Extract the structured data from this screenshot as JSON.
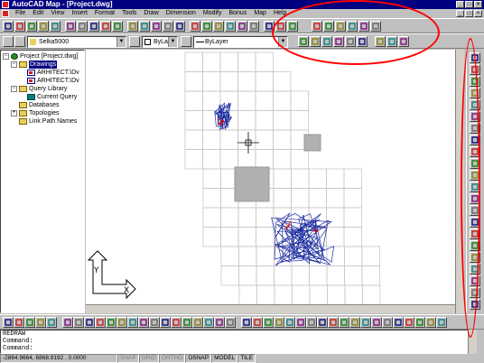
{
  "window": {
    "title": "AutoCAD Map - [Project.dwg]",
    "controls": [
      "_",
      "□",
      "×"
    ],
    "doc_controls": [
      "_",
      "□",
      "×"
    ]
  },
  "menu": [
    "File",
    "Edit",
    "View",
    "Insert",
    "Format",
    "Tools",
    "Draw",
    "Dimension",
    "Modify",
    "Bonus",
    "Map",
    "Help"
  ],
  "layer_bar": {
    "layer": "Selka5000",
    "color": "ByLayer",
    "linetype": "ByLayer"
  },
  "project_tree": [
    {
      "label": "Project [Project.dwg]",
      "level": 0,
      "expander": "−",
      "icon": "globe-icon"
    },
    {
      "label": "Drawings",
      "level": 1,
      "expander": "−",
      "icon": "folder-icon",
      "selected": true
    },
    {
      "label": "ARHITECT.\\Dv",
      "level": 2,
      "expander": "",
      "icon": "drawing-icon"
    },
    {
      "label": "ARHITECT.\\Dv",
      "level": 2,
      "expander": "",
      "icon": "drawing-icon"
    },
    {
      "label": "Query Library",
      "level": 1,
      "expander": "−",
      "icon": "folder-icon"
    },
    {
      "label": "Current Query",
      "level": 2,
      "expander": "",
      "icon": "query-icon"
    },
    {
      "label": "Databases",
      "level": 1,
      "expander": "",
      "icon": "folder-icon"
    },
    {
      "label": "Topologies",
      "level": 1,
      "expander": "+",
      "icon": "folder-icon"
    },
    {
      "label": "Link Path Names",
      "level": 1,
      "expander": "",
      "icon": "folder-icon"
    }
  ],
  "ucs": {
    "x": "X",
    "y": "Y"
  },
  "command": {
    "lines": [
      "REDRAW",
      "Command:",
      "Command:"
    ]
  },
  "status": {
    "coords": "-2864.9664, 6868.9192 , 0.0000",
    "toggles": [
      {
        "label": "SNAP",
        "on": false
      },
      {
        "label": "GRID",
        "on": false
      },
      {
        "label": "ORTHO",
        "on": false
      },
      {
        "label": "OSNAP",
        "on": true
      },
      {
        "label": "MODEL",
        "on": true
      },
      {
        "label": "TILE",
        "on": true
      }
    ]
  },
  "colors": {
    "titlebar": "#000080",
    "face": "#c0c0c0",
    "annotation": "#ff0000",
    "geometry_blue": "#1a2aa0",
    "geometry_red": "#d01010",
    "hatch": "#b0b0b0"
  }
}
